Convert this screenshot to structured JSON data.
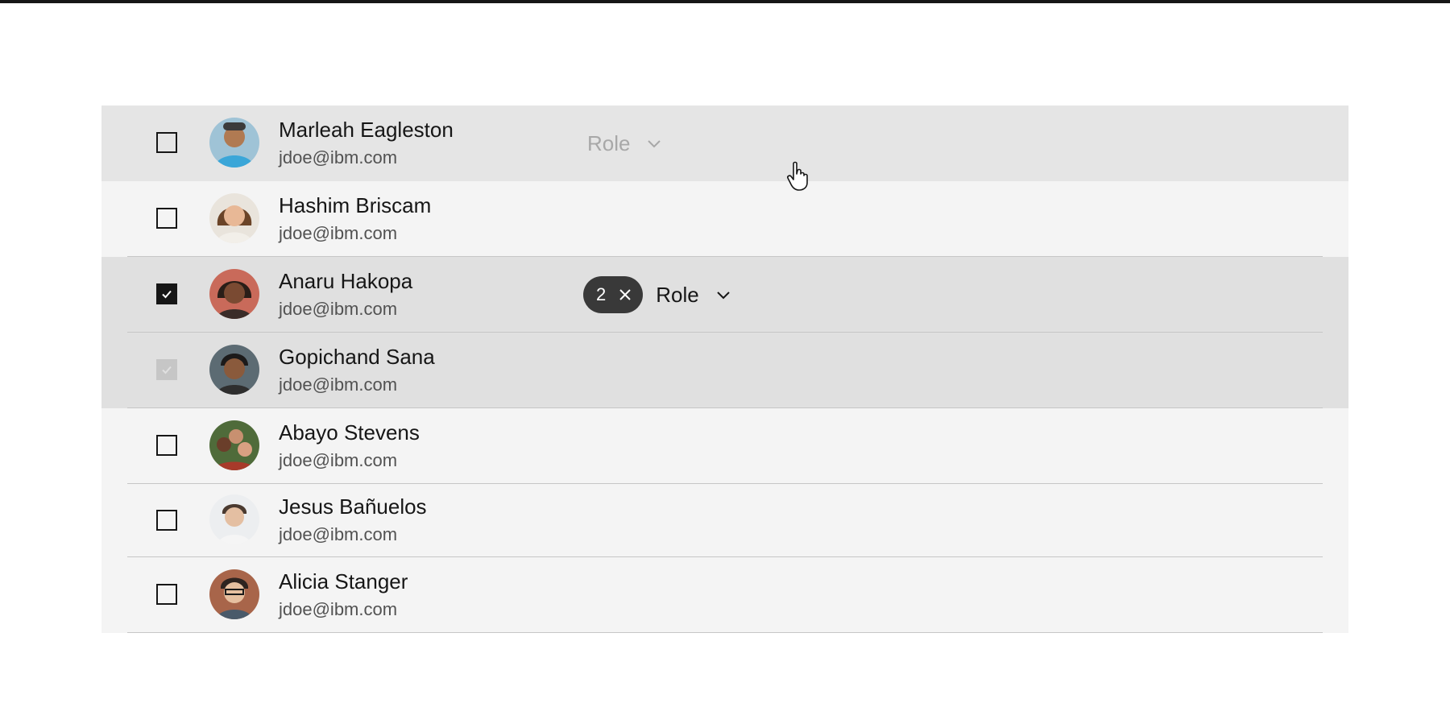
{
  "users": [
    {
      "name": "Marleah Eagleston",
      "email": "jdoe@ibm.com",
      "state": "unchecked",
      "row": "hover"
    },
    {
      "name": "Hashim Briscam",
      "email": "jdoe@ibm.com",
      "state": "unchecked",
      "row": "normal"
    },
    {
      "name": "Anaru Hakopa",
      "email": "jdoe@ibm.com",
      "state": "checked",
      "row": "selected"
    },
    {
      "name": "Gopichand Sana",
      "email": "jdoe@ibm.com",
      "state": "checked-disabled",
      "row": "selected"
    },
    {
      "name": "Abayo Stevens",
      "email": "jdoe@ibm.com",
      "state": "unchecked",
      "row": "normal"
    },
    {
      "name": "Jesus Bañuelos",
      "email": "jdoe@ibm.com",
      "state": "unchecked",
      "row": "normal"
    },
    {
      "name": "Alicia Stanger",
      "email": "jdoe@ibm.com",
      "state": "unchecked",
      "row": "normal"
    }
  ],
  "hover_role": {
    "label": "Role",
    "state": "disabled"
  },
  "selected_role": {
    "label": "Role",
    "tag_count": "2"
  },
  "icons": {
    "checkmark": "checkmark-icon",
    "chevron": "chevron-down-icon",
    "close": "close-icon",
    "cursor": "hand-cursor-icon"
  },
  "colors": {
    "selected_bg": "#e0e0e0",
    "hover_bg": "#e5e5e5",
    "row_bg": "#f4f4f4",
    "tag_bg": "#393939",
    "checkbox": "#161616"
  }
}
